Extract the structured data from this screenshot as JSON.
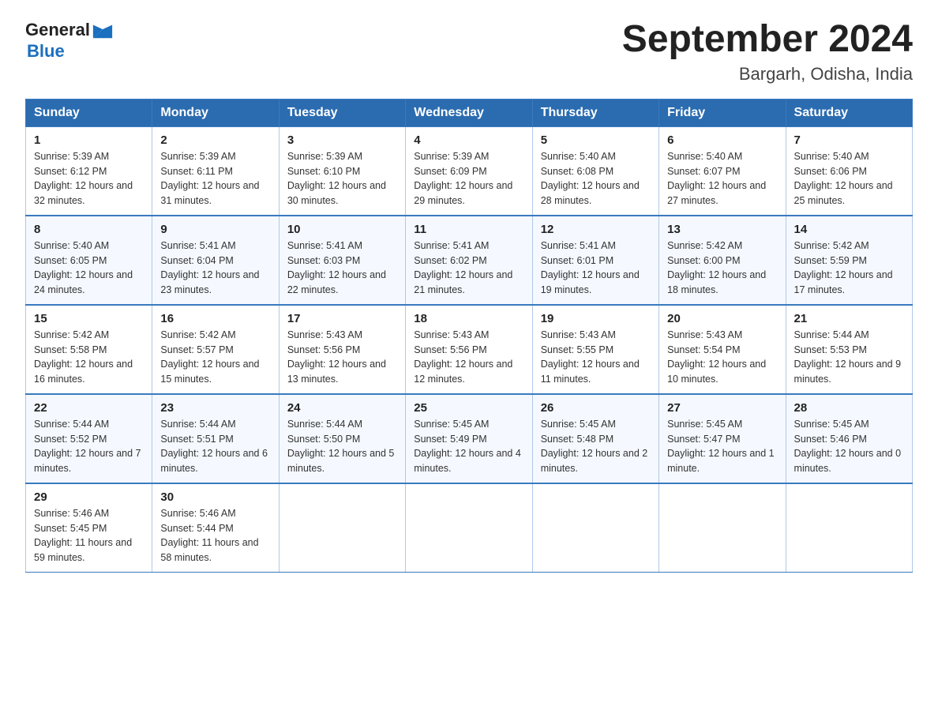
{
  "header": {
    "logo": {
      "general": "General",
      "blue": "Blue",
      "triangle_color": "#1a6fbf"
    },
    "title": "September 2024",
    "subtitle": "Bargarh, Odisha, India"
  },
  "weekdays": [
    "Sunday",
    "Monday",
    "Tuesday",
    "Wednesday",
    "Thursday",
    "Friday",
    "Saturday"
  ],
  "weeks": [
    [
      {
        "day": "1",
        "sunrise": "5:39 AM",
        "sunset": "6:12 PM",
        "daylight": "12 hours and 32 minutes."
      },
      {
        "day": "2",
        "sunrise": "5:39 AM",
        "sunset": "6:11 PM",
        "daylight": "12 hours and 31 minutes."
      },
      {
        "day": "3",
        "sunrise": "5:39 AM",
        "sunset": "6:10 PM",
        "daylight": "12 hours and 30 minutes."
      },
      {
        "day": "4",
        "sunrise": "5:39 AM",
        "sunset": "6:09 PM",
        "daylight": "12 hours and 29 minutes."
      },
      {
        "day": "5",
        "sunrise": "5:40 AM",
        "sunset": "6:08 PM",
        "daylight": "12 hours and 28 minutes."
      },
      {
        "day": "6",
        "sunrise": "5:40 AM",
        "sunset": "6:07 PM",
        "daylight": "12 hours and 27 minutes."
      },
      {
        "day": "7",
        "sunrise": "5:40 AM",
        "sunset": "6:06 PM",
        "daylight": "12 hours and 25 minutes."
      }
    ],
    [
      {
        "day": "8",
        "sunrise": "5:40 AM",
        "sunset": "6:05 PM",
        "daylight": "12 hours and 24 minutes."
      },
      {
        "day": "9",
        "sunrise": "5:41 AM",
        "sunset": "6:04 PM",
        "daylight": "12 hours and 23 minutes."
      },
      {
        "day": "10",
        "sunrise": "5:41 AM",
        "sunset": "6:03 PM",
        "daylight": "12 hours and 22 minutes."
      },
      {
        "day": "11",
        "sunrise": "5:41 AM",
        "sunset": "6:02 PM",
        "daylight": "12 hours and 21 minutes."
      },
      {
        "day": "12",
        "sunrise": "5:41 AM",
        "sunset": "6:01 PM",
        "daylight": "12 hours and 19 minutes."
      },
      {
        "day": "13",
        "sunrise": "5:42 AM",
        "sunset": "6:00 PM",
        "daylight": "12 hours and 18 minutes."
      },
      {
        "day": "14",
        "sunrise": "5:42 AM",
        "sunset": "5:59 PM",
        "daylight": "12 hours and 17 minutes."
      }
    ],
    [
      {
        "day": "15",
        "sunrise": "5:42 AM",
        "sunset": "5:58 PM",
        "daylight": "12 hours and 16 minutes."
      },
      {
        "day": "16",
        "sunrise": "5:42 AM",
        "sunset": "5:57 PM",
        "daylight": "12 hours and 15 minutes."
      },
      {
        "day": "17",
        "sunrise": "5:43 AM",
        "sunset": "5:56 PM",
        "daylight": "12 hours and 13 minutes."
      },
      {
        "day": "18",
        "sunrise": "5:43 AM",
        "sunset": "5:56 PM",
        "daylight": "12 hours and 12 minutes."
      },
      {
        "day": "19",
        "sunrise": "5:43 AM",
        "sunset": "5:55 PM",
        "daylight": "12 hours and 11 minutes."
      },
      {
        "day": "20",
        "sunrise": "5:43 AM",
        "sunset": "5:54 PM",
        "daylight": "12 hours and 10 minutes."
      },
      {
        "day": "21",
        "sunrise": "5:44 AM",
        "sunset": "5:53 PM",
        "daylight": "12 hours and 9 minutes."
      }
    ],
    [
      {
        "day": "22",
        "sunrise": "5:44 AM",
        "sunset": "5:52 PM",
        "daylight": "12 hours and 7 minutes."
      },
      {
        "day": "23",
        "sunrise": "5:44 AM",
        "sunset": "5:51 PM",
        "daylight": "12 hours and 6 minutes."
      },
      {
        "day": "24",
        "sunrise": "5:44 AM",
        "sunset": "5:50 PM",
        "daylight": "12 hours and 5 minutes."
      },
      {
        "day": "25",
        "sunrise": "5:45 AM",
        "sunset": "5:49 PM",
        "daylight": "12 hours and 4 minutes."
      },
      {
        "day": "26",
        "sunrise": "5:45 AM",
        "sunset": "5:48 PM",
        "daylight": "12 hours and 2 minutes."
      },
      {
        "day": "27",
        "sunrise": "5:45 AM",
        "sunset": "5:47 PM",
        "daylight": "12 hours and 1 minute."
      },
      {
        "day": "28",
        "sunrise": "5:45 AM",
        "sunset": "5:46 PM",
        "daylight": "12 hours and 0 minutes."
      }
    ],
    [
      {
        "day": "29",
        "sunrise": "5:46 AM",
        "sunset": "5:45 PM",
        "daylight": "11 hours and 59 minutes."
      },
      {
        "day": "30",
        "sunrise": "5:46 AM",
        "sunset": "5:44 PM",
        "daylight": "11 hours and 58 minutes."
      },
      null,
      null,
      null,
      null,
      null
    ]
  ]
}
